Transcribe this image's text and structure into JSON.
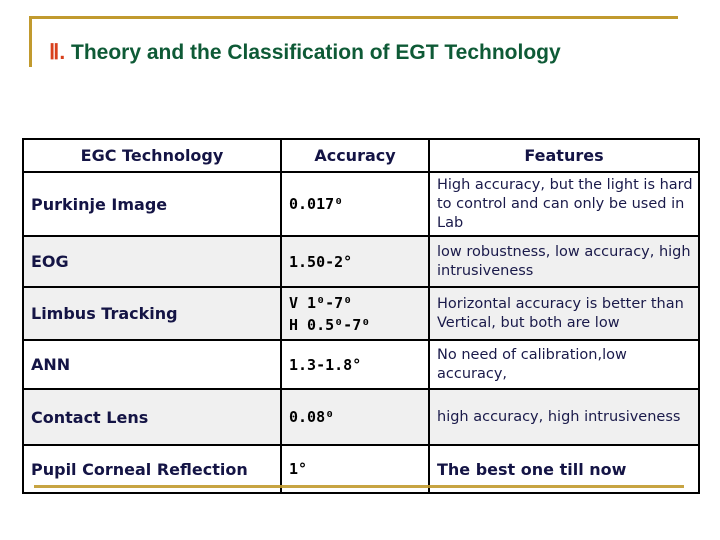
{
  "slide": {
    "title_numeral": "Ⅱ.",
    "title_text": " Theory and the Classification of EGT Technology",
    "accent_color": "#c19a2e",
    "title_color": "#0e5a36",
    "numeral_color": "#d8401c"
  },
  "table": {
    "headers": [
      "EGC Technology",
      "Accuracy",
      "Features"
    ],
    "rows": [
      {
        "technology": "Purkinje Image",
        "accuracy": [
          "0.017⁰"
        ],
        "features": "High accuracy, but the light is hard to control and can only be used in Lab",
        "shaded": false
      },
      {
        "technology": "EOG",
        "accuracy": [
          "1.50-2°"
        ],
        "features": "low robustness, low accuracy, high intrusiveness",
        "shaded": true
      },
      {
        "technology": "Limbus Tracking",
        "accuracy": [
          "V 1⁰-7⁰",
          "H 0.5⁰-7⁰"
        ],
        "features": "Horizontal accuracy is better than Vertical, but both are low",
        "shaded": true
      },
      {
        "technology": "ANN",
        "accuracy": [
          "1.3-1.8°"
        ],
        "features": "No need of calibration,low accuracy,",
        "shaded": false
      },
      {
        "technology": "Contact Lens",
        "accuracy": [
          "0.08⁰"
        ],
        "features": "high accuracy, high intrusiveness",
        "shaded": true
      },
      {
        "technology": "Pupil Corneal Reflection",
        "accuracy": [
          "1°"
        ],
        "features": "The best one till now",
        "shaded": false,
        "highlight": true
      }
    ]
  }
}
